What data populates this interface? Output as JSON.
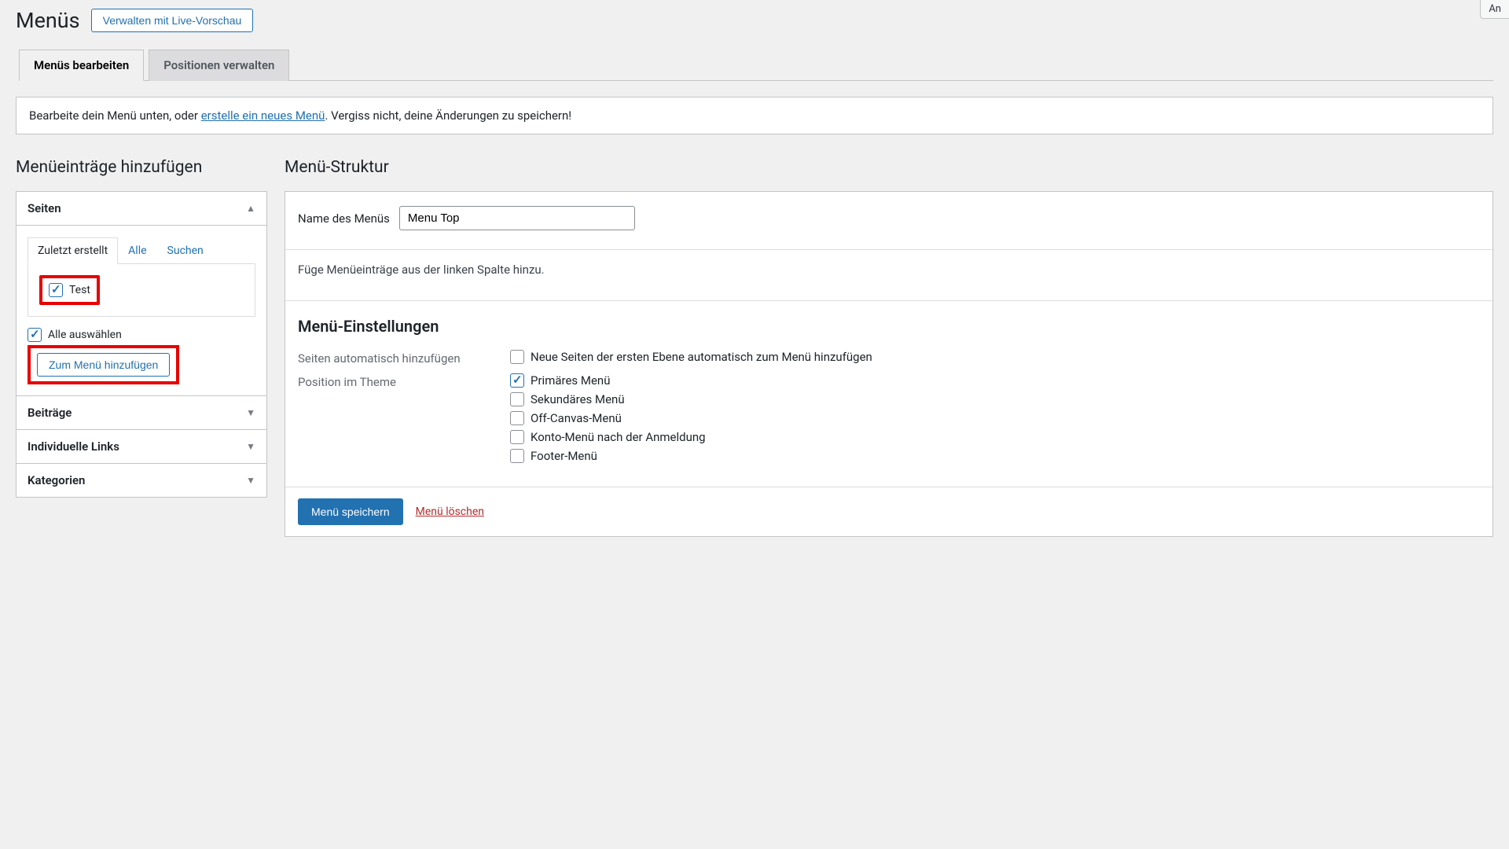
{
  "screen_options_label": "An",
  "page": {
    "title": "Menüs",
    "live_preview_button": "Verwalten mit Live-Vorschau"
  },
  "tabs": {
    "edit": "Menüs bearbeiten",
    "locations": "Positionen verwalten"
  },
  "notice": {
    "pre": "Bearbeite dein Menü unten, oder ",
    "link": "erstelle ein neues Menü",
    "post": ". Vergiss nicht, deine Änderungen zu speichern!"
  },
  "left": {
    "heading": "Menüeinträge hinzufügen",
    "pages": {
      "title": "Seiten",
      "tabs": {
        "recent": "Zuletzt erstellt",
        "all": "Alle",
        "search": "Suchen"
      },
      "items": [
        {
          "label": "Test",
          "checked": true
        }
      ],
      "select_all": "Alle auswählen",
      "add_button": "Zum Menü hinzufügen"
    },
    "posts_title": "Beiträge",
    "custom_links_title": "Individuelle Links",
    "categories_title": "Kategorien"
  },
  "right": {
    "heading": "Menü-Struktur",
    "name_label": "Name des Menüs",
    "name_value": "Menu Top",
    "instructions": "Füge Menüeinträge aus der linken Spalte hinzu.",
    "settings_heading": "Menü-Einstellungen",
    "auto_add_label": "Seiten automatisch hinzufügen",
    "auto_add_option": "Neue Seiten der ersten Ebene automatisch zum Menü hinzufügen",
    "theme_location_label": "Position im Theme",
    "locations": [
      {
        "label": "Primäres Menü",
        "checked": true
      },
      {
        "label": "Sekundäres Menü",
        "checked": false
      },
      {
        "label": "Off-Canvas-Menü",
        "checked": false
      },
      {
        "label": "Konto-Menü nach der Anmeldung",
        "checked": false
      },
      {
        "label": "Footer-Menü",
        "checked": false
      }
    ],
    "save_button": "Menü speichern",
    "delete_link": "Menü löschen"
  }
}
